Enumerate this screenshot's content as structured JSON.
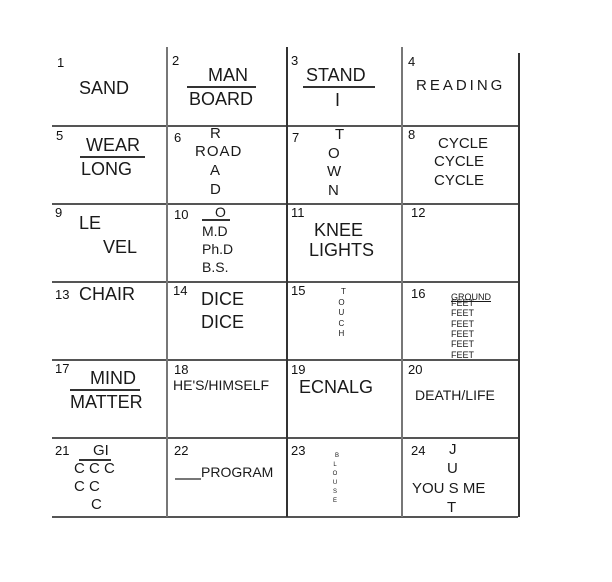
{
  "title": "Word puzzle grid (rebus)",
  "cells": [
    {
      "num": "1",
      "lines": [
        "SAND"
      ]
    },
    {
      "num": "2",
      "top": "MAN",
      "bottom": "BOARD"
    },
    {
      "num": "3",
      "top": "STAND",
      "bottom": "I"
    },
    {
      "num": "4",
      "lines": [
        "READING"
      ]
    },
    {
      "num": "5",
      "top": "WEAR",
      "bottom": "LONG"
    },
    {
      "num": "6",
      "vertical": [
        "R",
        "ROAD",
        "A",
        "D"
      ]
    },
    {
      "num": "7",
      "vertical": [
        "T",
        "O",
        "W",
        "N"
      ]
    },
    {
      "num": "8",
      "lines": [
        "CYCLE",
        "CYCLE",
        "CYCLE"
      ]
    },
    {
      "num": "9",
      "lines": [
        "LE",
        "VEL"
      ]
    },
    {
      "num": "10",
      "top": "O",
      "lines": [
        "M.D",
        "Ph.D",
        "B.S."
      ]
    },
    {
      "num": "11",
      "lines": [
        "KNEE",
        "LIGHTS"
      ]
    },
    {
      "num": "12",
      "lines": []
    },
    {
      "num": "13",
      "lines": [
        "CHAIR"
      ]
    },
    {
      "num": "14",
      "lines": [
        "DICE",
        "DICE"
      ]
    },
    {
      "num": "15",
      "vertical": [
        "T",
        "O",
        "U",
        "C",
        "H"
      ]
    },
    {
      "num": "16",
      "top": "GROUND",
      "lines": [
        "FEET",
        "FEET",
        "FEET",
        "FEET",
        "FEET",
        "FEET"
      ]
    },
    {
      "num": "17",
      "top": "MIND",
      "bottom": "MATTER"
    },
    {
      "num": "18",
      "lines": [
        "HE'S/HIMSELF"
      ]
    },
    {
      "num": "19",
      "lines": [
        "ECNALG"
      ]
    },
    {
      "num": "20",
      "lines": [
        "DEATH/LIFE"
      ]
    },
    {
      "num": "21",
      "top": "GI",
      "lines": [
        "C C C",
        "C C",
        "C"
      ]
    },
    {
      "num": "22",
      "lines": [
        "PROGRAM"
      ]
    },
    {
      "num": "23",
      "vertical": [
        "B",
        "L",
        "O",
        "U",
        "S",
        "E"
      ]
    },
    {
      "num": "24",
      "vertical": [
        "J",
        "U",
        "YOU S ME",
        "T"
      ]
    }
  ]
}
